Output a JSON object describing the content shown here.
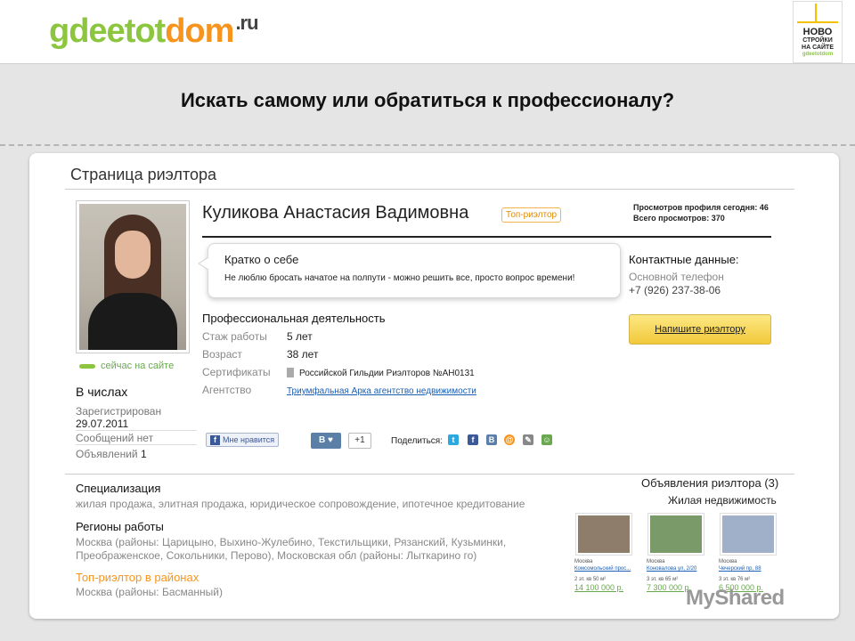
{
  "header": {
    "logo": {
      "part1": "gdeetot",
      "part2": "dom",
      "part3": ".ru"
    },
    "badge": {
      "line1": "НОВО",
      "line2": "СТРОЙКИ",
      "line3": "НА САЙТЕ",
      "line4": "gdeetotdom"
    }
  },
  "slide_title": "Искать самому или обратиться к профессионалу?",
  "page": {
    "heading": "Страница риэлтора",
    "profile": {
      "name": "Куликова Анастасия Вадимовна",
      "top_badge": "Топ-риэлтор",
      "views_today": "Просмотров профиля сегодня: 46",
      "views_total": "Всего просмотров: 370",
      "about_title": "Кратко о себе",
      "about_text": "Не люблю бросать начатое на полпути - можно решить все, просто вопрос времени!",
      "online": "сейчас на сайте",
      "numbers_title": "В числах",
      "registered_label": "Зарегистрирован",
      "registered_value": "29.07.2011",
      "messages": "Сообщений нет",
      "ads_label": "Объявлений",
      "ads_count": "1",
      "contacts_title": "Контактные данные:",
      "phone_label": "Основной телефон",
      "phone": "+7 (926) 237-38-06",
      "write_button": "Напишите риэлтору",
      "pro_title": "Профессиональная деятельность",
      "pro": [
        {
          "label": "Стаж работы",
          "value": "5 лет"
        },
        {
          "label": "Возраст",
          "value": "38 лет"
        },
        {
          "label": "Сертификаты",
          "value": "Российской Гильдии Риэлторов №АН0131"
        },
        {
          "label": "Агентство",
          "value": "Триумфальная Арка агентство недвижимости"
        }
      ],
      "like_label": "Мне нравится",
      "vk_label": "В",
      "plus_one": "+1",
      "share_label": "Поделиться:"
    },
    "specialization_title": "Специализация",
    "specialization_text": "жилая продажа, элитная продажа, юридическое сопровождение, ипотечное кредитование",
    "regions_title": "Регионы работы",
    "regions_text": "Москва (районы: Царицыно, Выхино-Жулебино, Текстильщики, Рязанский, Кузьминки, Преображенское, Сокольники, Перово), Московская обл (районы: Лыткарино го)",
    "top_districts_title": "Топ-риэлтор в районах",
    "top_districts_text": "Москва (районы: Басманный)",
    "ads_title": "Объявления риэлтора (3)",
    "ads_subtitle": "Жилая недвижимость",
    "ads": [
      {
        "city": "Москва",
        "address": "Комсомольский прос...",
        "spec": "2 эт. кв 50 м²",
        "price": "14 100 000 р.",
        "color": "#8d7d6a"
      },
      {
        "city": "Москва",
        "address": "Коновалова ул, 2/20",
        "spec": "3 эт. кв 65 м²",
        "price": "7 300 000 р.",
        "color": "#7a9a6a"
      },
      {
        "city": "Москва",
        "address": "Чечерский пр, 88",
        "spec": "3 эт. кв 76 м²",
        "price": "6 500 000 р.",
        "color": "#9fb0c8"
      }
    ]
  },
  "watermark": "MyShared"
}
